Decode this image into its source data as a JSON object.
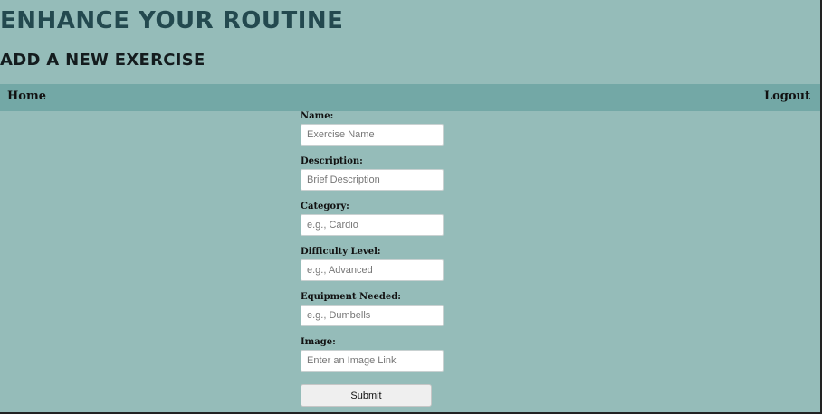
{
  "header": {
    "title": "ENHANCE YOUR ROUTINE",
    "subtitle": "ADD A NEW EXERCISE"
  },
  "nav": {
    "home": "Home",
    "logout": "Logout"
  },
  "form": {
    "fields": [
      {
        "label": "Name:",
        "placeholder": "Exercise Name",
        "value": ""
      },
      {
        "label": "Description:",
        "placeholder": "Brief Description",
        "value": ""
      },
      {
        "label": "Category:",
        "placeholder": "e.g., Cardio",
        "value": ""
      },
      {
        "label": "Difficulty Level:",
        "placeholder": "e.g., Advanced",
        "value": ""
      },
      {
        "label": "Equipment Needed:",
        "placeholder": "e.g., Dumbells",
        "value": ""
      },
      {
        "label": "Image:",
        "placeholder": "Enter an Image Link",
        "value": ""
      }
    ],
    "submit_label": "Submit"
  },
  "colors": {
    "page_background": "#95bcb9",
    "navbar_background": "#73a8a6",
    "title_color": "#23494f"
  }
}
